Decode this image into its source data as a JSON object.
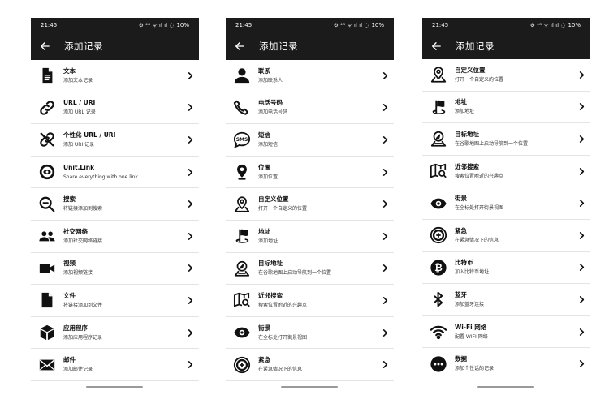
{
  "status": {
    "time": "21:45",
    "battery": "10%",
    "icons": "⚙ ⁴ᴳ ᯤ ıl ıl ◌"
  },
  "appbar": {
    "title": "添加记录"
  },
  "screens": [
    {
      "items": [
        {
          "icon": "document-icon",
          "title": "文本",
          "subtitle": "添加文本记录"
        },
        {
          "icon": "link-icon",
          "title": "URL / URI",
          "subtitle": "添加 URL 记录"
        },
        {
          "icon": "link-off-icon",
          "title": "个性化 URL / URI",
          "subtitle": "添加 URI 记录"
        },
        {
          "icon": "unitlink-icon",
          "title": "Unit.Link",
          "subtitle": "Share everything with one link"
        },
        {
          "icon": "search-icon",
          "title": "搜索",
          "subtitle": "将链接添加到搜索"
        },
        {
          "icon": "social-icon",
          "title": "社交网络",
          "subtitle": "添加社交网络链接"
        },
        {
          "icon": "video-icon",
          "title": "视频",
          "subtitle": "添加视频链接"
        },
        {
          "icon": "file-icon",
          "title": "文件",
          "subtitle": "将链接添加到文件"
        },
        {
          "icon": "app-icon",
          "title": "应用程序",
          "subtitle": "添加应用程序记录"
        },
        {
          "icon": "mail-icon",
          "title": "邮件",
          "subtitle": "添加邮件记录"
        }
      ]
    },
    {
      "items": [
        {
          "icon": "contact-icon",
          "title": "联系",
          "subtitle": "添加联系人"
        },
        {
          "icon": "phone-icon",
          "title": "电话号码",
          "subtitle": "添加电话号码"
        },
        {
          "icon": "sms-icon",
          "title": "短信",
          "subtitle": "添加短信"
        },
        {
          "icon": "location-pin-icon",
          "title": "位置",
          "subtitle": "添加位置"
        },
        {
          "icon": "custom-location-icon",
          "title": "自定义位置",
          "subtitle": "打开一个自定义的位置"
        },
        {
          "icon": "address-flag-icon",
          "title": "地址",
          "subtitle": "添加地址"
        },
        {
          "icon": "navigation-icon",
          "title": "目标地址",
          "subtitle": "在谷歌地图上启动导航到一个位置"
        },
        {
          "icon": "nearby-search-icon",
          "title": "近邻搜索",
          "subtitle": "搜索位置附近的兴趣点"
        },
        {
          "icon": "street-view-icon",
          "title": "街景",
          "subtitle": "在全标处打开街景视图"
        },
        {
          "icon": "emergency-icon",
          "title": "紧急",
          "subtitle": "在紧急情况下的信息"
        }
      ]
    },
    {
      "items": [
        {
          "icon": "custom-location-icon",
          "title": "自定义位置",
          "subtitle": "打开一个自定义的位置"
        },
        {
          "icon": "address-flag-icon",
          "title": "地址",
          "subtitle": "添加地址"
        },
        {
          "icon": "navigation-icon",
          "title": "目标地址",
          "subtitle": "在谷歌地图上启动导航到一个位置"
        },
        {
          "icon": "nearby-search-icon",
          "title": "近邻搜索",
          "subtitle": "搜索位置附近的兴趣点"
        },
        {
          "icon": "street-view-icon",
          "title": "街景",
          "subtitle": "在全标处打开街景视图"
        },
        {
          "icon": "emergency-icon",
          "title": "紧急",
          "subtitle": "在紧急情况下的信息"
        },
        {
          "icon": "bitcoin-icon",
          "title": "比特币",
          "subtitle": "加入比特币地址"
        },
        {
          "icon": "bluetooth-icon",
          "title": "蓝牙",
          "subtitle": "添加蓝牙连接"
        },
        {
          "icon": "wifi-icon",
          "title": "Wi-Fi 网络",
          "subtitle": "配置 WIFI 网络"
        },
        {
          "icon": "more-data-icon",
          "title": "数据",
          "subtitle": "添加个性话的记录"
        }
      ]
    }
  ]
}
